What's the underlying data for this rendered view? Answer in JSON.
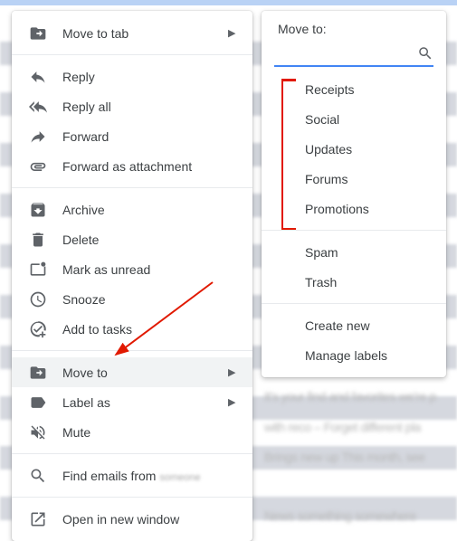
{
  "context_menu": {
    "move_to_tab": "Move to tab",
    "reply": "Reply",
    "reply_all": "Reply all",
    "forward": "Forward",
    "forward_attachment": "Forward as attachment",
    "archive": "Archive",
    "delete": "Delete",
    "mark_unread": "Mark as unread",
    "snooze": "Snooze",
    "add_to_tasks": "Add to tasks",
    "move_to": "Move to",
    "label_as": "Label as",
    "mute": "Mute",
    "find_emails_from": "Find emails from",
    "open_new_window": "Open in new window"
  },
  "submenu": {
    "title": "Move to:",
    "labels": {
      "receipts": "Receipts",
      "social": "Social",
      "updates": "Updates",
      "forums": "Forums",
      "promotions": "Promotions"
    },
    "spam": "Spam",
    "trash": "Trash",
    "create_new": "Create new",
    "manage_labels": "Manage labels"
  }
}
